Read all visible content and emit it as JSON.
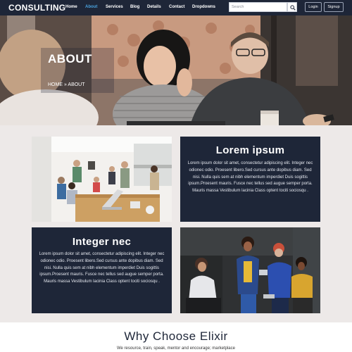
{
  "navbar": {
    "brand": "CONSULTING",
    "links": [
      {
        "label": "Home",
        "active": false
      },
      {
        "label": "About",
        "active": true
      },
      {
        "label": "Services",
        "active": false
      },
      {
        "label": "Blog",
        "active": false
      },
      {
        "label": "Details",
        "active": false
      },
      {
        "label": "Contact",
        "active": false
      },
      {
        "label": "Dropdowns",
        "active": false
      }
    ],
    "search_placeholder": "Search",
    "login_label": "Login",
    "signup_label": "Signup"
  },
  "hero": {
    "title": "ABOUT",
    "breadcrumb": "HOME » ABOUT"
  },
  "cards": [
    {
      "title": "Lorem ipsum",
      "body": "Lorem ipsum dolor sit amet, consectetur adipiscing elit. Integer nec odionec odio. Proesent libero.Sed cursus ante dopibus diam. Sed nisi. Nulla quis sem at nibh elementum imperdiet Duis sogittis ipsum.Proesent mauris. Fusce nec tellus sed augue semper porta. Mauris massa Vestibulum lacinia Class optent tociti sociosqu ."
    },
    {
      "title": "Integer nec",
      "body": "Lorem ipsum dolor sit amet, consectetur adipiscing elit. Integer nec odionec odio. Proesent libero.Sed cursus ante dopibus diam. Sed nisi. Nulla quis sem at nibh elementum imperdiet Duis sogittis ipsum.Proesent mauris. Fusce nec tellus sed augue semper porta. Mauris massa Vestibulum lacinia Class optent tociti sociosqu ."
    }
  ],
  "why": {
    "title": "Why Choose Elixir",
    "subtitle": "We resource, train, speak, mentor and encourage; marketplace"
  },
  "colors": {
    "navy": "#1e2638",
    "accent": "#4aa3df",
    "background": "#ede9e8"
  }
}
